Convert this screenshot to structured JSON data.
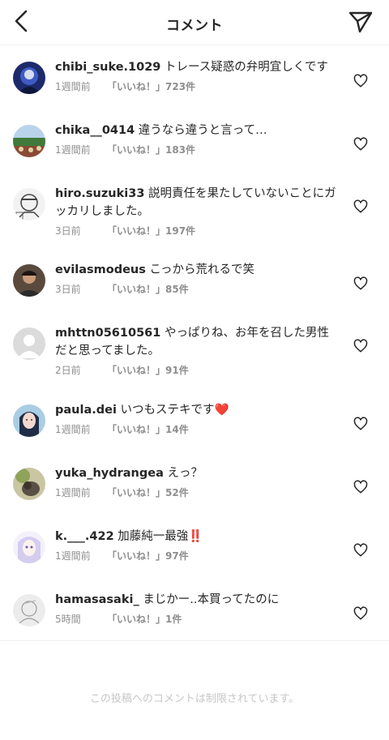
{
  "header": {
    "title": "コメント",
    "back_icon": "chevron-left-icon",
    "send_icon": "paper-plane-icon"
  },
  "comments": [
    {
      "username": "chibi_suke.1029",
      "text": "トレース疑惑の弁明宜しくです",
      "time": "1週間前",
      "likes": "「いいね！」723件"
    },
    {
      "username": "chika__0414",
      "text": "違うなら違うと言って…",
      "time": "1週間前",
      "likes": "「いいね！」183件"
    },
    {
      "username": "hiro.suzuki33",
      "text": "説明責任を果たしていないことにガッカリしました。",
      "time": "3日前",
      "likes": "「いいね！」197件"
    },
    {
      "username": "evilasmodeus",
      "text": "こっから荒れるで笑",
      "time": "3日前",
      "likes": "「いいね！」85件"
    },
    {
      "username": "mhttn05610561",
      "text": "やっぱりね、お年を召した男性だと思ってました。",
      "time": "2日前",
      "likes": "「いいね！」91件"
    },
    {
      "username": "paula.dei",
      "text": "いつもステキです❤️",
      "time": "1週間前",
      "likes": "「いいね！」14件"
    },
    {
      "username": "yuka_hydrangea",
      "text": "えっ？",
      "time": "1週間前",
      "likes": "「いいね！」52件"
    },
    {
      "username": "k.___.422",
      "text": "加藤純一最強‼️",
      "time": "1週間前",
      "likes": "「いいね！」97件"
    },
    {
      "username": "hamasasaki_",
      "text": "まじかー..本買ってたのに",
      "time": "5時間",
      "likes": "「いいね！」1件"
    }
  ],
  "footer": {
    "restricted_text": "この投稿へのコメントは制限されています。"
  },
  "colors": {
    "text": "#262626",
    "meta": "#8e8e8e",
    "restricted": "#c7c7c7",
    "divider": "#efefef"
  }
}
